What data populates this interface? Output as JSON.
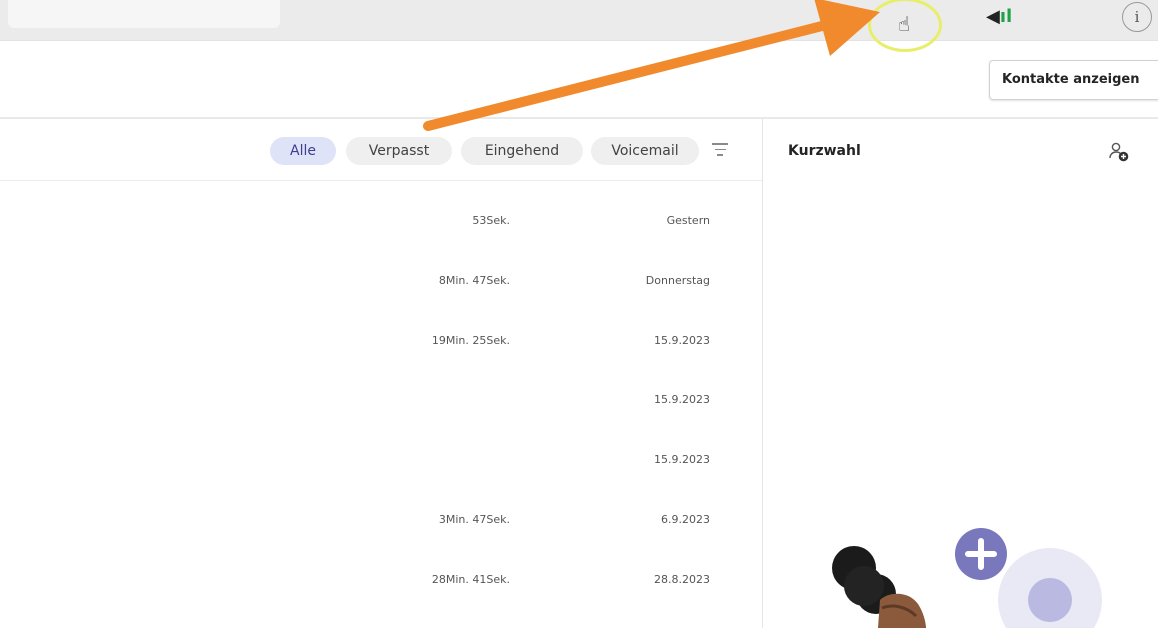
{
  "header": {
    "contacts_button": "Kontakte anzeigen"
  },
  "filters": {
    "chips": [
      "Alle",
      "Verpasst",
      "Eingehend",
      "Voicemail"
    ],
    "active": "Alle"
  },
  "speed_dial": {
    "title": "Kurzwahl"
  },
  "calls": [
    {
      "duration": "53Sek.",
      "date": "Gestern"
    },
    {
      "duration": "8Min. 47Sek.",
      "date": "Donnerstag"
    },
    {
      "duration": "19Min. 25Sek.",
      "date": "15.9.2023"
    },
    {
      "duration": "",
      "date": "15.9.2023"
    },
    {
      "duration": "",
      "date": "15.9.2023"
    },
    {
      "duration": "3Min. 47Sek.",
      "date": "6.9.2023"
    },
    {
      "duration": "28Min. 41Sek.",
      "date": "28.8.2023"
    }
  ],
  "icons": {
    "toolbar": [
      "hand-cursor-icon",
      "volume-icon",
      "info-icon"
    ],
    "filter": "filter-icon",
    "add_contact": "add-contact-icon",
    "illustration_plus": "plus-circle-icon"
  },
  "colors": {
    "accent_chip_bg": "#dfe3f7",
    "accent_chip_text": "#3d3f8f",
    "arrow": "#f08a2c",
    "highlight_ring": "#e7ef6a",
    "plus_circle": "#7a78bd"
  }
}
